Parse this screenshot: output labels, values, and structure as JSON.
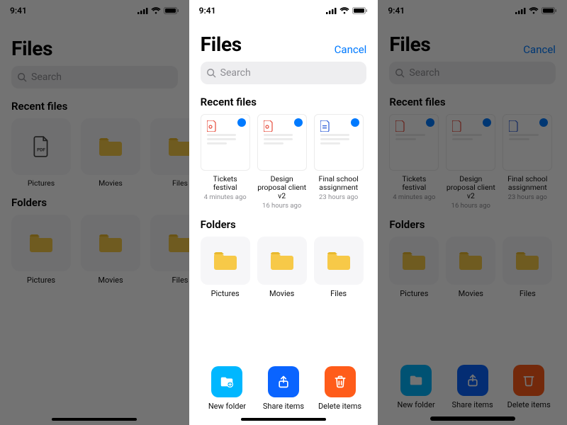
{
  "status": {
    "time": "9:41"
  },
  "header": {
    "title": "Files",
    "cancel": "Cancel"
  },
  "search": {
    "placeholder": "Search"
  },
  "sections": {
    "recent": "Recent files",
    "folders": "Folders"
  },
  "recent": [
    {
      "name": "Tickets festival",
      "time": "4 minutes ago",
      "icon": "pdf",
      "selected": true
    },
    {
      "name": "Design proposal client v2",
      "time": "16 hours ago",
      "icon": "pdf",
      "selected": true
    },
    {
      "name": "Final school assignment",
      "time": "23 hours ago",
      "icon": "doc",
      "selected": true
    }
  ],
  "bg_recent": [
    {
      "name": "Pictures",
      "icon": "pdf-dark"
    },
    {
      "name": "Movies",
      "icon": "folder"
    },
    {
      "name": "Files",
      "icon": "folder"
    }
  ],
  "folders": [
    {
      "name": "Pictures"
    },
    {
      "name": "Movies"
    },
    {
      "name": "Files"
    }
  ],
  "actions": {
    "new_folder": "New folder",
    "share": "Share items",
    "delete": "Delete items"
  },
  "colors": {
    "accent": "#007aff",
    "cyan": "#00b7ff",
    "blue": "#0a64ff",
    "orange": "#ff5c1a",
    "folder": "#f7c948"
  }
}
